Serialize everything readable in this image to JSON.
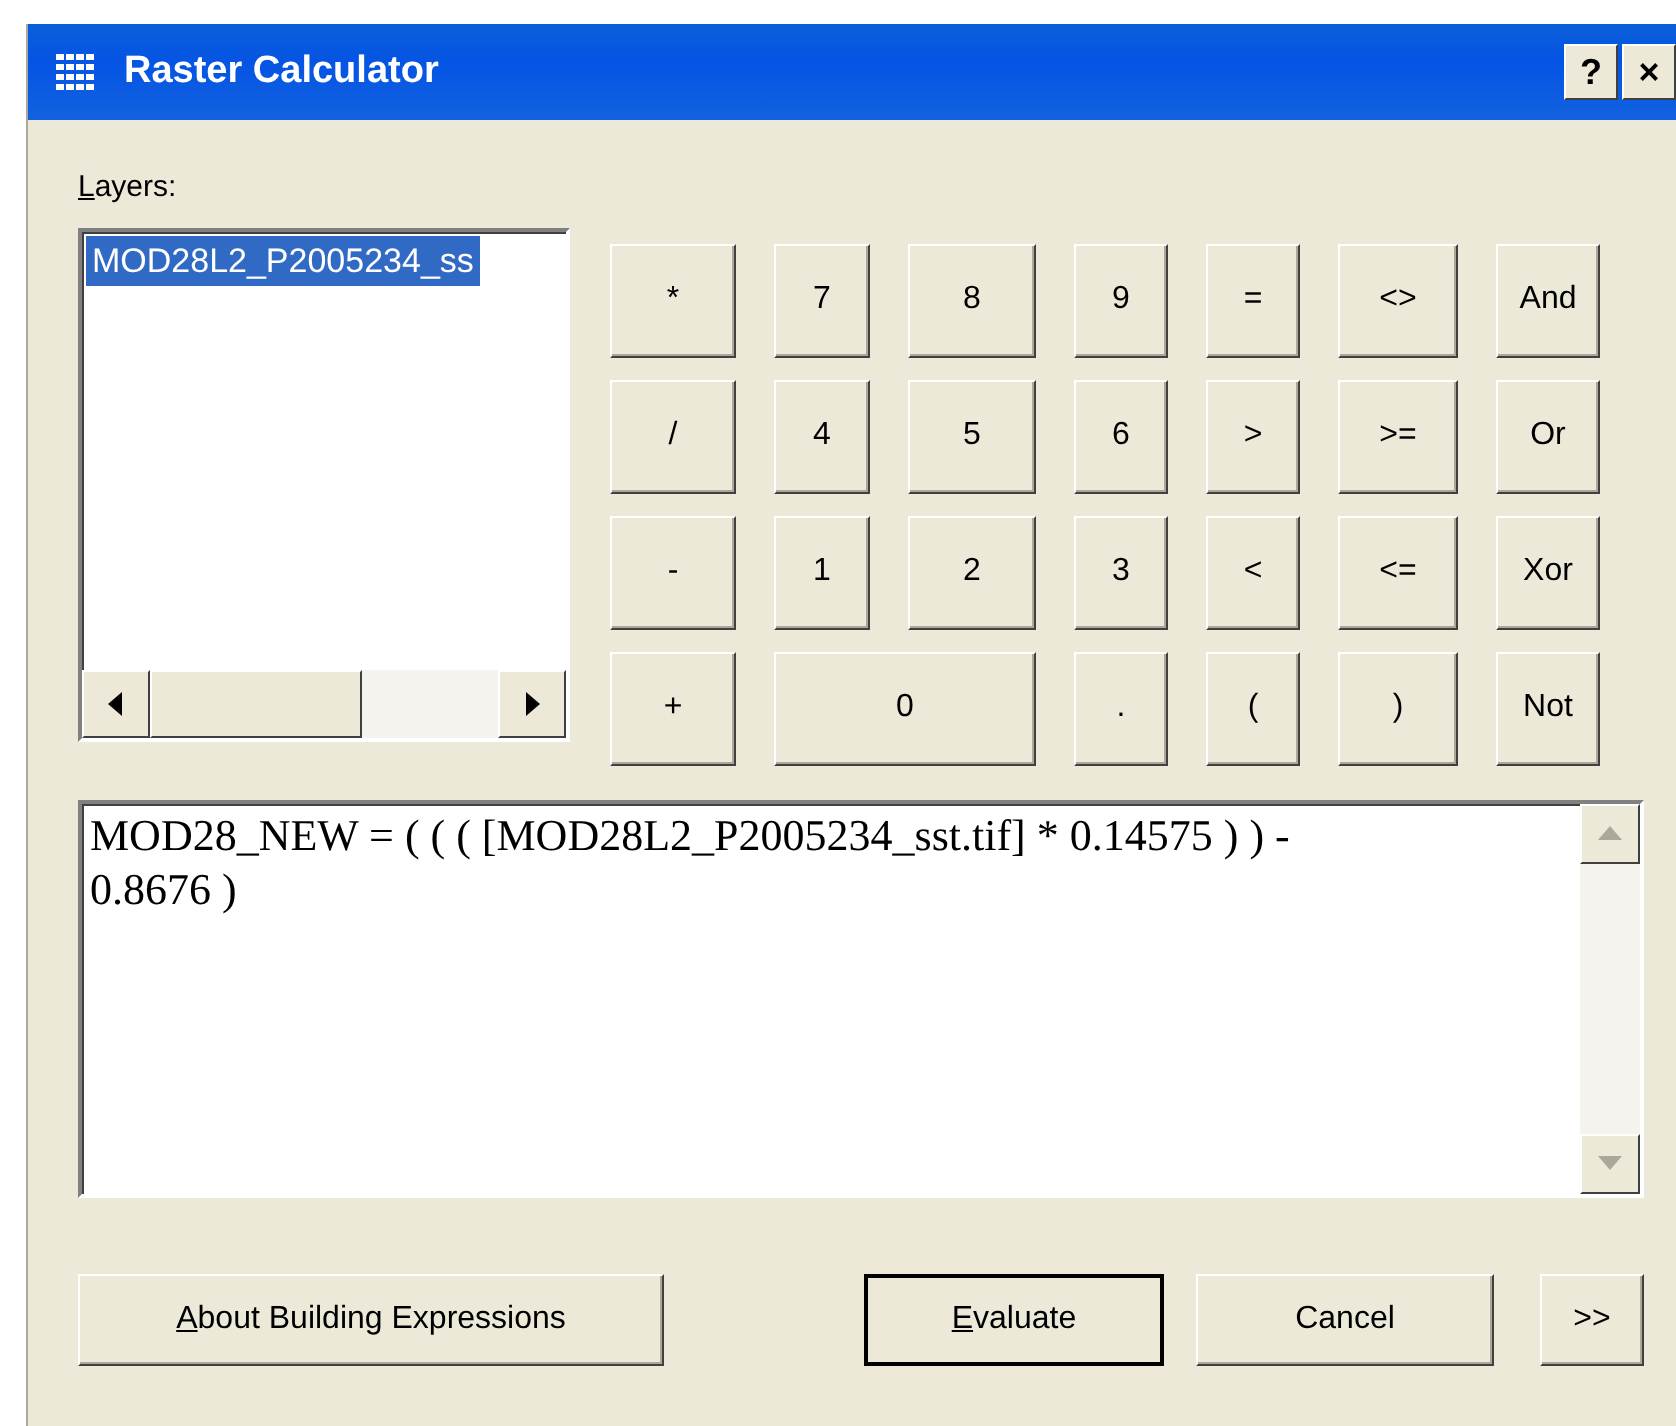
{
  "window": {
    "title": "Raster Calculator",
    "title_buttons": [
      "?",
      "×"
    ]
  },
  "layers": {
    "label": "Layers:",
    "mnemonic_underlined": true,
    "items": [
      {
        "name": "MOD28L2_P2005234_ss",
        "selected": true
      }
    ]
  },
  "keypad": [
    [
      {
        "label": "*",
        "kind": "key"
      },
      {
        "label": "7",
        "kind": "key"
      },
      {
        "label": "8",
        "kind": "key"
      },
      {
        "label": "9",
        "kind": "key"
      },
      {
        "label": "=",
        "kind": "key"
      },
      {
        "label": "<>",
        "kind": "key"
      },
      {
        "label": "And",
        "kind": "key"
      }
    ],
    [
      {
        "label": "/",
        "kind": "key"
      },
      {
        "label": "4",
        "kind": "key"
      },
      {
        "label": "5",
        "kind": "key"
      },
      {
        "label": "6",
        "kind": "key"
      },
      {
        "label": ">",
        "kind": "key"
      },
      {
        "label": ">=",
        "kind": "key"
      },
      {
        "label": "Or",
        "kind": "key"
      }
    ],
    [
      {
        "label": "-",
        "kind": "key"
      },
      {
        "label": "1",
        "kind": "key"
      },
      {
        "label": "2",
        "kind": "key"
      },
      {
        "label": "3",
        "kind": "key"
      },
      {
        "label": "<",
        "kind": "key"
      },
      {
        "label": "<=",
        "kind": "key"
      },
      {
        "label": "Xor",
        "kind": "key"
      }
    ],
    [
      {
        "label": "+",
        "kind": "key"
      },
      {
        "label": "0",
        "kind": "wide"
      },
      {
        "label": ".",
        "kind": "key"
      },
      {
        "label": "(",
        "kind": "key"
      },
      {
        "label": ")",
        "kind": "key"
      },
      {
        "label": "Not",
        "kind": "key"
      }
    ]
  ],
  "expression": "MOD28_NEW = ( ( ( [MOD28L2_P2005234_sst.tif] * 0.14575 ) ) - 0.8676 )",
  "buttons": [
    {
      "label": "About Building Expressions",
      "mnemonic_underlined": true,
      "default": false
    },
    {
      "label": "Evaluate",
      "mnemonic_underlined": true,
      "default": true
    },
    {
      "label": "Cancel",
      "default": false
    },
    {
      "label": ">>",
      "default": false
    }
  ]
}
